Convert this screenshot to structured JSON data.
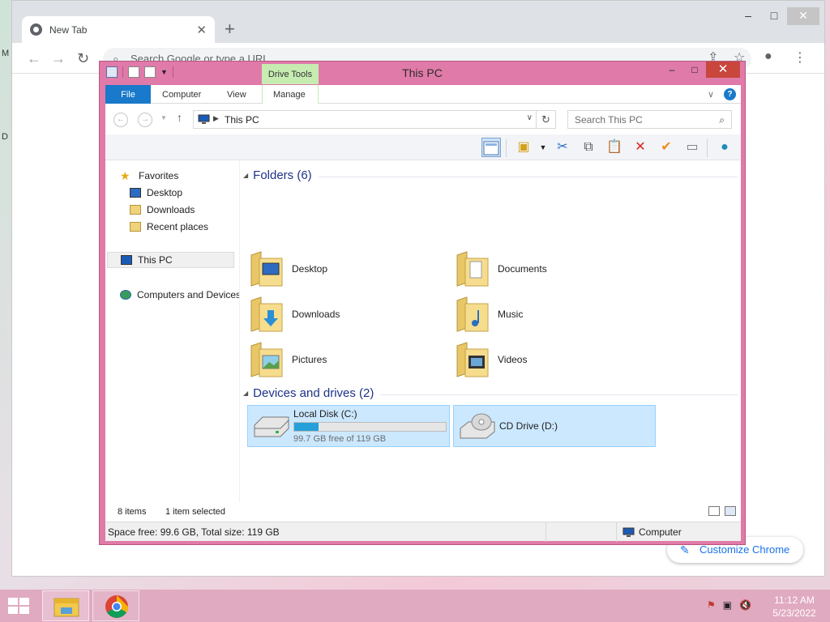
{
  "chrome": {
    "tab_title": "New Tab",
    "tab_close": "✕",
    "new_tab": "+",
    "omnibox_placeholder": "Search Google or type a URL",
    "customize_label": "Customize Chrome",
    "desktop_glyphs": [
      "M",
      "D"
    ]
  },
  "explorer": {
    "title": "This PC",
    "context_tab": "Drive Tools",
    "ribbon_tabs": {
      "file": "File",
      "computer": "Computer",
      "view": "View",
      "manage": "Manage"
    },
    "address": "This PC",
    "search_placeholder": "Search This PC",
    "nav": {
      "favorites": "Favorites",
      "desktop": "Desktop",
      "downloads": "Downloads",
      "recent": "Recent places",
      "thispc": "This PC",
      "network": "Computers and Devices"
    },
    "groups": {
      "folders": "Folders (6)",
      "devices": "Devices and drives (2)"
    },
    "folders": {
      "desktop": "Desktop",
      "documents": "Documents",
      "downloads": "Downloads",
      "music": "Music",
      "pictures": "Pictures",
      "videos": "Videos"
    },
    "drives": {
      "c_name": "Local Disk (C:)",
      "c_free": "99.7 GB free of 119 GB",
      "c_used_fraction": 0.16,
      "d_name": "CD Drive (D:)"
    },
    "status": {
      "items": "8 items",
      "selected": "1 item selected"
    },
    "details": {
      "space": "Space free: 99.6 GB, Total size: 119 GB",
      "computer": "Computer"
    }
  },
  "taskbar": {
    "time": "11:12 AM",
    "date": "5/23/2022"
  },
  "colors": {
    "window_frame": "#e07aa8",
    "accent": "#1979ca",
    "drive_tools": "#c7ecb1",
    "selection": "#cce8ff",
    "taskbar": "#e0aac0"
  }
}
